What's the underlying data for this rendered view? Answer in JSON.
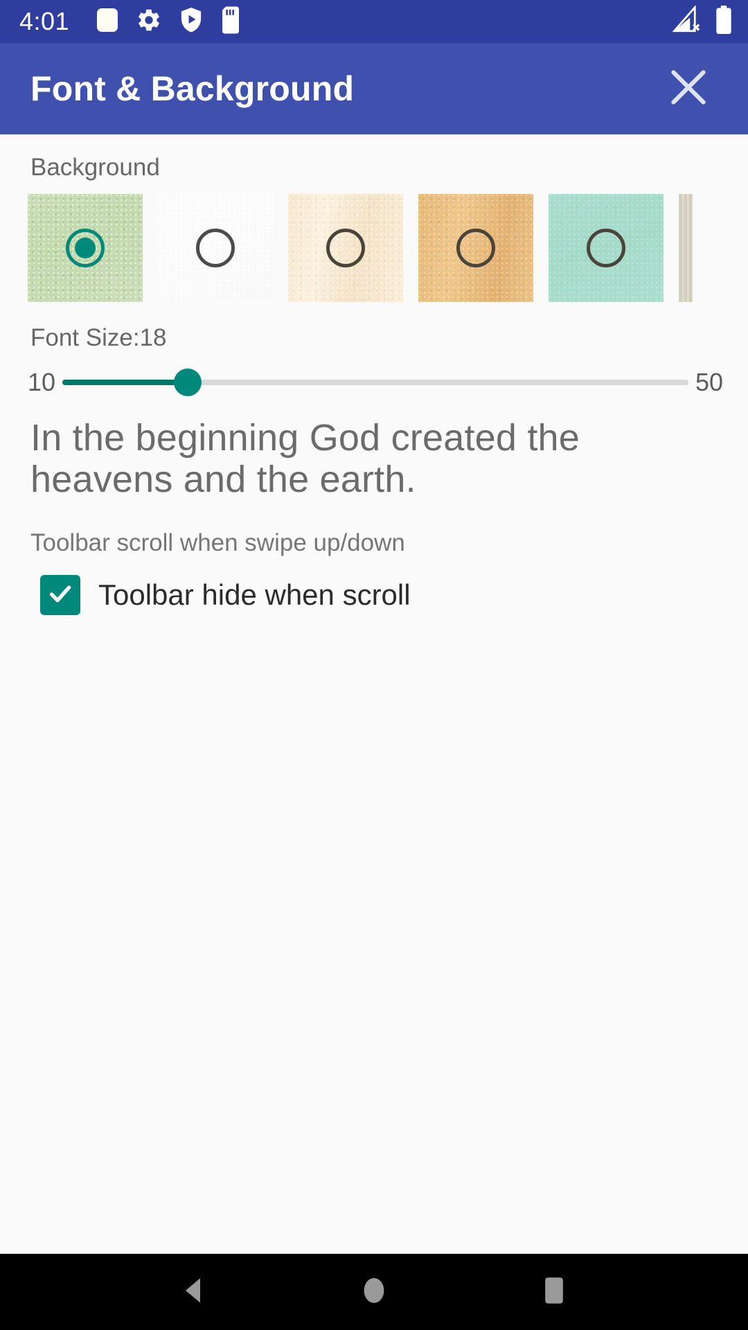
{
  "status_bar": {
    "time": "4:01",
    "left_icons": [
      "app-square-icon",
      "gear-icon",
      "shield-play-icon",
      "sd-card-icon"
    ],
    "right_icons": [
      "signal-off-icon",
      "battery-icon"
    ],
    "background_color": "#2F3E9E"
  },
  "app_bar": {
    "title": "Font & Background",
    "close_icon": "close-icon",
    "background_color": "#3F51AC"
  },
  "background_section": {
    "label": "Background",
    "swatches": [
      {
        "name": "green-paper",
        "selected": true,
        "tex": "tex-green",
        "radio_class": "selected"
      },
      {
        "name": "white-plain",
        "selected": false,
        "tex": "tex-white",
        "radio_class": ""
      },
      {
        "name": "cream-paper",
        "selected": false,
        "tex": "tex-cream",
        "radio_class": "dark-border"
      },
      {
        "name": "tan-paper",
        "selected": false,
        "tex": "tex-tan",
        "radio_class": "dark-border"
      },
      {
        "name": "mint-paper",
        "selected": false,
        "tex": "tex-mint",
        "radio_class": "dark-border"
      }
    ]
  },
  "font_size_section": {
    "label": "Font Size:18",
    "value": 18,
    "min_label": "10",
    "max_label": "50",
    "min": 10,
    "max": 50,
    "fill_percent": "20%",
    "accent_color": "#00897B"
  },
  "preview": {
    "text": "In the beginning God created the heavens and the earth."
  },
  "toolbar_section": {
    "label": "Toolbar scroll when swipe up/down",
    "checkbox_label": "Toolbar hide when scroll",
    "checked": true,
    "accent_color": "#00897B"
  },
  "nav_bar": {
    "buttons": [
      "back-button",
      "home-button",
      "recents-button"
    ],
    "background_color": "#000000"
  }
}
